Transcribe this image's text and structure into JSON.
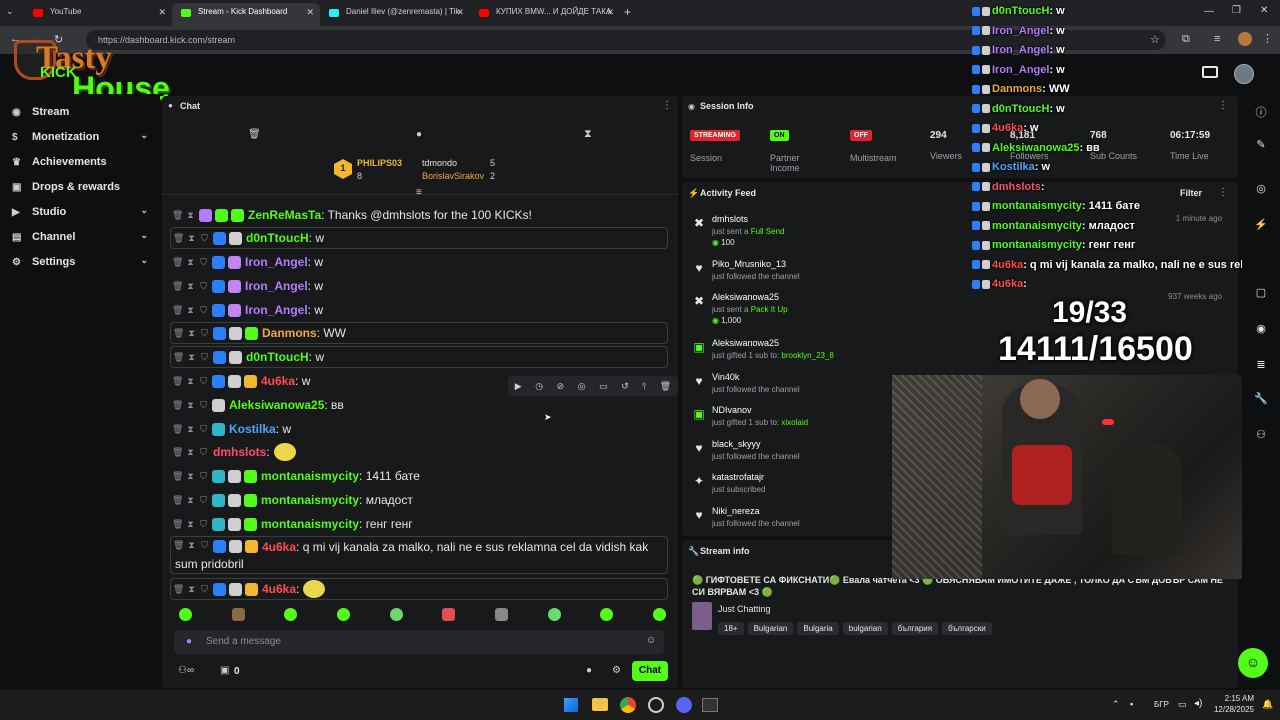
{
  "browser": {
    "tabs": [
      {
        "label": "YouTube",
        "color": "#ff0000"
      },
      {
        "label": "Stream - Kick Dashboard",
        "color": "#53fc18"
      },
      {
        "label": "Daniel Iliev (@zenremasta) | Tik",
        "color": "#25f4ee"
      },
      {
        "label": "КУПИХ BMW... И ДОЙДЕ ТАКА",
        "color": "#ff0000"
      }
    ],
    "url": "https://dashboard.kick.com/stream"
  },
  "logo": {
    "line1": "Tasty",
    "line2": "House",
    "kick": "KICK"
  },
  "nav": {
    "items": [
      {
        "label": "Stream",
        "icon": "stream-icon",
        "chevron": false
      },
      {
        "label": "Monetization",
        "icon": "dollar-icon",
        "chevron": true
      },
      {
        "label": "Achievements",
        "icon": "trophy-icon",
        "chevron": false
      },
      {
        "label": "Drops & rewards",
        "icon": "gift-icon",
        "chevron": false
      },
      {
        "label": "Studio",
        "icon": "studio-icon",
        "chevron": true
      },
      {
        "label": "Channel",
        "icon": "channel-icon",
        "chevron": true
      },
      {
        "label": "Settings",
        "icon": "gear-icon",
        "chevron": true
      }
    ]
  },
  "chat": {
    "title": "Chat",
    "leaderboard": {
      "first": {
        "rank": "1",
        "name": "PHILIPS03",
        "count": "8"
      },
      "second": {
        "name": "tdmondo",
        "count": "5"
      },
      "third": {
        "name": "BorislavSirakov",
        "count": "2"
      }
    },
    "messages": [
      {
        "user": "ZenReMasTa",
        "color": "#53fc18",
        "text": ": Thanks @dmhslots for the 100 KICKs!",
        "boxed": false
      },
      {
        "user": "d0nTtoucH",
        "color": "#53fc18",
        "text": ": w",
        "boxed": true
      },
      {
        "user": "Iron_Angel",
        "color": "#b57cff",
        "text": ": w",
        "boxed": false
      },
      {
        "user": "Iron_Angel",
        "color": "#b57cff",
        "text": ": w",
        "boxed": false
      },
      {
        "user": "Iron_Angel",
        "color": "#b57cff",
        "text": ": w",
        "boxed": false
      },
      {
        "user": "Danmons",
        "color": "#f2a83b",
        "text": ": WW",
        "boxed": true
      },
      {
        "user": "d0nTtoucH",
        "color": "#53fc18",
        "text": ": w",
        "boxed": true
      },
      {
        "user": "4u6ka",
        "color": "#ff4d4d",
        "text": ": w",
        "boxed": false
      },
      {
        "user": "Aleksiwanowa25",
        "color": "#53fc18",
        "text": ": вв",
        "boxed": false
      },
      {
        "user": "Kostilka",
        "color": "#4da6ff",
        "text": ": w",
        "boxed": false
      },
      {
        "user": "dmhslots",
        "color": "#ff4d6d",
        "text": ":",
        "boxed": false
      },
      {
        "user": "montanaismycity",
        "color": "#53fc18",
        "text": ": 1411 бате",
        "boxed": false
      },
      {
        "user": "montanaismycity",
        "color": "#53fc18",
        "text": ": младост",
        "boxed": false
      },
      {
        "user": "montanaismycity",
        "color": "#53fc18",
        "text": ": генг генг",
        "boxed": false
      },
      {
        "user": "4u6ka",
        "color": "#ff4d4d",
        "text": ": q mi vij kanala za malko, nali ne e sus reklamna cel da vidish kak",
        "text2": "sum pridobril",
        "boxed": true
      },
      {
        "user": "4u6ka",
        "color": "#ff4d4d",
        "text": ":",
        "boxed": true
      }
    ],
    "input_placeholder": "Send a message",
    "footer_count": "0",
    "chat_button": "Chat"
  },
  "session": {
    "title": "Session Info",
    "streaming_badge": "STREAMING",
    "session_label": "Session",
    "partner_badge": "ON",
    "partner_label": "Partner Income",
    "multistream_badge": "OFF",
    "multistream_label": "Multistream",
    "viewers_value": "294",
    "viewers_label": "Viewers",
    "followers_value": "8,181",
    "followers_label": "Followers",
    "subs_value": "768",
    "subs_label": "Sub Counts",
    "time_value": "06:17:59",
    "time_label": "Time Live"
  },
  "activity": {
    "title": "Activity Feed",
    "filter_label": "Filter",
    "items": [
      {
        "name": "dmhslots",
        "desc": "just sent a ",
        "highlight": "Full Send",
        "extra": "100",
        "time": "1 minute ago",
        "icon": "kick-icon"
      },
      {
        "name": "Piko_Mrusniko_13",
        "desc": "just followed the channel",
        "highlight": "",
        "extra": "",
        "time": "",
        "icon": "heart-icon"
      },
      {
        "name": "Aleksiwanowa25",
        "desc": "just sent a ",
        "highlight": "Pack It Up",
        "extra": "1,000",
        "time": "937 weeks ago",
        "icon": "kick-icon"
      },
      {
        "name": "Aleksiwanowa25",
        "desc": "just gifted 1 sub to: ",
        "highlight": "brooklyn_23_8",
        "extra": "",
        "time": "",
        "icon": "gift-icon"
      },
      {
        "name": "Vin40k",
        "desc": "just followed the channel",
        "highlight": "",
        "extra": "",
        "time": "",
        "icon": "heart-icon"
      },
      {
        "name": "NDIvanov",
        "desc": "just gifted 1 sub to: ",
        "highlight": "xixolaid",
        "extra": "",
        "time": "",
        "icon": "gift-icon"
      },
      {
        "name": "black_skyyy",
        "desc": "just followed the channel",
        "highlight": "",
        "extra": "",
        "time": "",
        "icon": "heart-icon"
      },
      {
        "name": "katastrofatajr",
        "desc": "just subscribed",
        "highlight": "",
        "extra": "",
        "time": "",
        "icon": "star-icon"
      },
      {
        "name": "Niki_nereza",
        "desc": "just followed the channel",
        "highlight": "",
        "extra": "",
        "time": "",
        "icon": "heart-icon"
      }
    ]
  },
  "streaminfo": {
    "title": "Stream info",
    "stream_title": "🟢 ГИФТОВЕТЕ СА ФИКСНАТИ🟢 Евала чатчета <3 🟢 ОБЯСНЯВАМ ИМОТИТЕ ДАЖЕ , ТОЛКО ДА СЪМ ДОБЪР САМ НЕ СИ ВЯРВАМ <3 🟢",
    "category": "Just Chatting",
    "tags": [
      "18+",
      "Bulgarian",
      "Bulgaria",
      "bulgarian",
      "българия",
      "български"
    ]
  },
  "overlay": {
    "goal1": "19/33",
    "goal2": "14111/16500",
    "chat": [
      {
        "user": "d0nTtoucH",
        "text": ": w",
        "color": "#53fc18"
      },
      {
        "user": "Iron_Angel",
        "text": ": w",
        "color": "#b57cff"
      },
      {
        "user": "Iron_Angel",
        "text": ": w",
        "color": "#b57cff"
      },
      {
        "user": "Iron_Angel",
        "text": ": w",
        "color": "#b57cff"
      },
      {
        "user": "Danmons",
        "text": ": WW",
        "color": "#f2a83b"
      },
      {
        "user": "d0nTtoucH",
        "text": ": w",
        "color": "#53fc18"
      },
      {
        "user": "4u6ka",
        "text": ": w",
        "color": "#ff4d4d"
      },
      {
        "user": "Aleksiwanowa25",
        "text": ": вв",
        "color": "#53fc18"
      },
      {
        "user": "Kostilka",
        "text": ": w",
        "color": "#4da6ff"
      },
      {
        "user": "dmhslots",
        "text": ":",
        "color": "#ff4d6d"
      },
      {
        "user": "montanaismycity",
        "text": ": 1411 бате",
        "color": "#53fc18"
      },
      {
        "user": "montanaismycity",
        "text": ": младост",
        "color": "#53fc18"
      },
      {
        "user": "montanaismycity",
        "text": ": генг генг",
        "color": "#53fc18"
      },
      {
        "user": "4u6ka",
        "text": ": q mi vij kanala za malko, nali ne e sus reklamna c",
        "color": "#ff4d4d"
      },
      {
        "user": "4u6ka",
        "text": ":",
        "color": "#ff4d4d"
      }
    ]
  },
  "taskbar": {
    "lang": "БГР",
    "time": "2:15 AM",
    "date": "12/28/2025"
  },
  "colors": {
    "accent": "#53fc18",
    "red": "#e0242b",
    "panel": "#18191b",
    "bg": "#0e0f11"
  }
}
